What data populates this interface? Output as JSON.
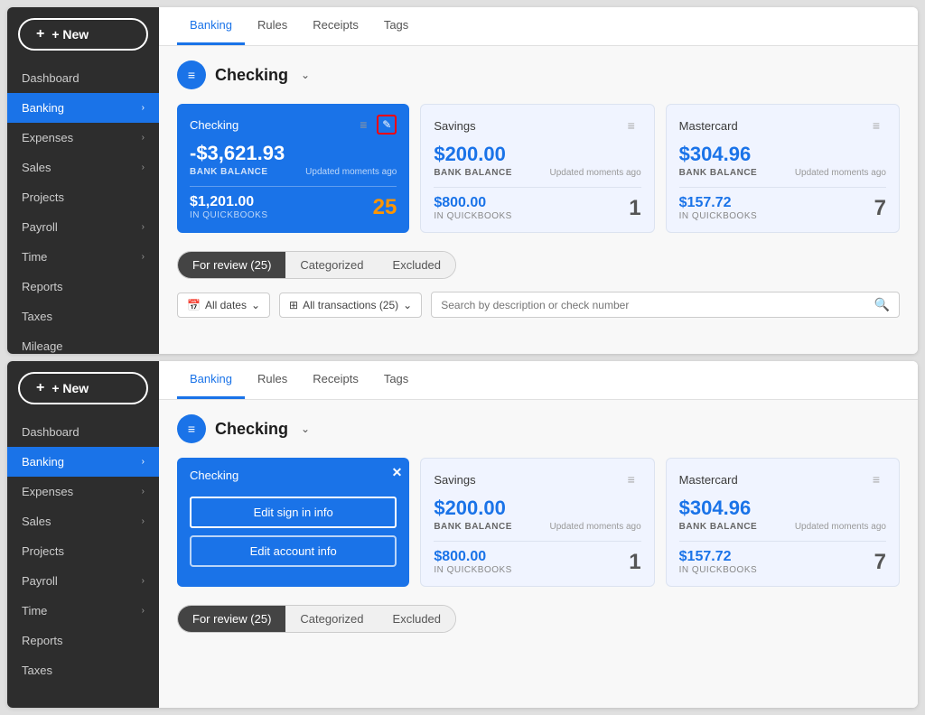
{
  "panel1": {
    "sidebar": {
      "new_label": "+ New",
      "nav_items": [
        {
          "label": "Dashboard",
          "active": false,
          "has_chevron": false
        },
        {
          "label": "Banking",
          "active": true,
          "has_chevron": true
        },
        {
          "label": "Expenses",
          "active": false,
          "has_chevron": true
        },
        {
          "label": "Sales",
          "active": false,
          "has_chevron": true
        },
        {
          "label": "Projects",
          "active": false,
          "has_chevron": false
        },
        {
          "label": "Payroll",
          "active": false,
          "has_chevron": true
        },
        {
          "label": "Time",
          "active": false,
          "has_chevron": true
        },
        {
          "label": "Reports",
          "active": false,
          "has_chevron": false
        },
        {
          "label": "Taxes",
          "active": false,
          "has_chevron": false
        },
        {
          "label": "Mileage",
          "active": false,
          "has_chevron": false
        }
      ]
    },
    "tabs": [
      "Banking",
      "Rules",
      "Receipts",
      "Tags"
    ],
    "active_tab": "Banking",
    "account_name": "Checking",
    "cards": [
      {
        "type": "blue",
        "name": "Checking",
        "bank_balance": "-$3,621.93",
        "bank_label": "BANK BALANCE",
        "updated": "Updated moments ago",
        "in_qb_amount": "$1,201.00",
        "in_qb_label": "IN QUICKBOOKS",
        "count": "25",
        "has_edit_icon": true
      },
      {
        "type": "light",
        "name": "Savings",
        "bank_balance": "$200.00",
        "bank_label": "BANK BALANCE",
        "updated": "Updated moments ago",
        "in_qb_amount": "$800.00",
        "in_qb_label": "IN QUICKBOOKS",
        "count": "1"
      },
      {
        "type": "light",
        "name": "Mastercard",
        "bank_balance": "$304.96",
        "bank_label": "BANK BALANCE",
        "updated": "Updated moments ago",
        "in_qb_amount": "$157.72",
        "in_qb_label": "IN QUICKBOOKS",
        "count": "7"
      }
    ],
    "filter_tabs": [
      "For review (25)",
      "Categorized",
      "Excluded"
    ],
    "active_filter": "For review (25)",
    "all_dates_label": "All dates",
    "all_transactions_label": "All transactions (25)",
    "search_placeholder": "Search by description or check number"
  },
  "panel2": {
    "sidebar": {
      "new_label": "+ New",
      "nav_items": [
        {
          "label": "Dashboard",
          "active": false,
          "has_chevron": false
        },
        {
          "label": "Banking",
          "active": true,
          "has_chevron": true
        },
        {
          "label": "Expenses",
          "active": false,
          "has_chevron": true
        },
        {
          "label": "Sales",
          "active": false,
          "has_chevron": true
        },
        {
          "label": "Projects",
          "active": false,
          "has_chevron": false
        },
        {
          "label": "Payroll",
          "active": false,
          "has_chevron": true
        },
        {
          "label": "Time",
          "active": false,
          "has_chevron": true
        },
        {
          "label": "Reports",
          "active": false,
          "has_chevron": false
        },
        {
          "label": "Taxes",
          "active": false,
          "has_chevron": false
        }
      ]
    },
    "tabs": [
      "Banking",
      "Rules",
      "Receipts",
      "Tags"
    ],
    "active_tab": "Banking",
    "account_name": "Checking",
    "cards": [
      {
        "type": "blue_dropdown",
        "name": "Checking",
        "edit_sign_in_label": "Edit sign in info",
        "edit_account_label": "Edit account info"
      },
      {
        "type": "light",
        "name": "Savings",
        "bank_balance": "$200.00",
        "bank_label": "BANK BALANCE",
        "updated": "Updated moments ago",
        "in_qb_amount": "$800.00",
        "in_qb_label": "IN QUICKBOOKS",
        "count": "1"
      },
      {
        "type": "light",
        "name": "Mastercard",
        "bank_balance": "$304.96",
        "bank_label": "BANK BALANCE",
        "updated": "Updated moments ago",
        "in_qb_amount": "$157.72",
        "in_qb_label": "IN QUICKBOOKS",
        "count": "7"
      }
    ],
    "filter_tabs": [
      "For review (25)",
      "Categorized",
      "Excluded"
    ],
    "active_filter": "For review (25)"
  }
}
